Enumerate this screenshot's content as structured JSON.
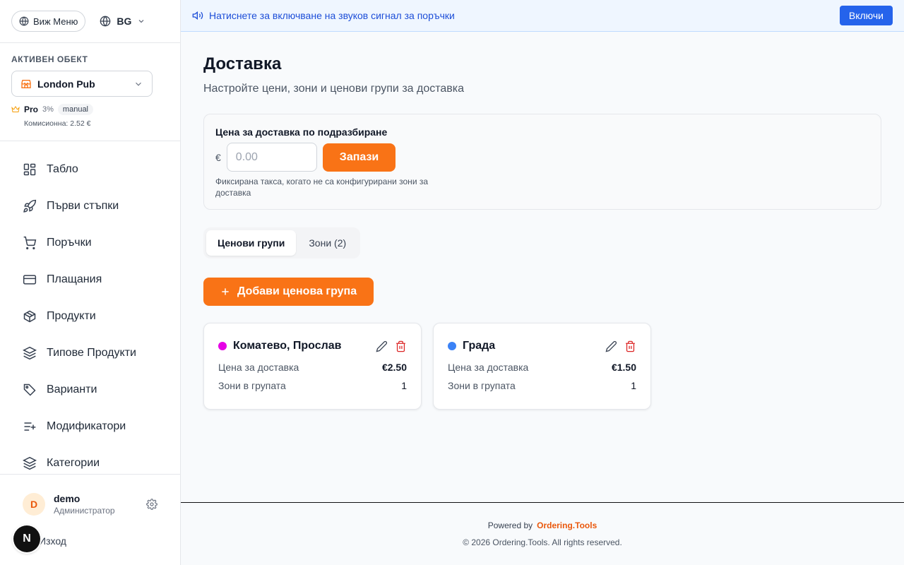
{
  "sidebar": {
    "menu_button": "Виж Меню",
    "language": "BG",
    "active_object_label": "Активен обект",
    "active_object": "London Pub",
    "plan": {
      "name": "Pro",
      "percent": "3%",
      "badge": "manual",
      "commission": "Комисионна: 2.52 €"
    },
    "nav": [
      {
        "label": "Табло",
        "icon": "dashboard-icon"
      },
      {
        "label": "Първи стъпки",
        "icon": "rocket-icon"
      },
      {
        "label": "Поръчки",
        "icon": "cart-icon"
      },
      {
        "label": "Плащания",
        "icon": "credit-card-icon"
      },
      {
        "label": "Продукти",
        "icon": "box-icon"
      },
      {
        "label": "Типове Продукти",
        "icon": "layers-icon"
      },
      {
        "label": "Варианти",
        "icon": "tag-icon"
      },
      {
        "label": "Модификатори",
        "icon": "list-plus-icon"
      },
      {
        "label": "Категории",
        "icon": "layers-icon"
      }
    ],
    "user": {
      "initial": "D",
      "name": "demo",
      "role": "Администратор",
      "logout": "Изход"
    },
    "dev_badge": "N"
  },
  "banner": {
    "text": "Натиснете за включване на звуков сигнал за поръчки",
    "button": "Включи"
  },
  "main": {
    "title": "Доставка",
    "subtitle": "Настройте цени, зони и ценови групи за доставка",
    "default_price": {
      "label": "Цена за доставка по подразбиране",
      "currency": "€",
      "placeholder": "0.00",
      "save": "Запази",
      "hint": "Фиксирана такса, когато не са конфигурирани зони за доставка"
    },
    "tabs": [
      {
        "label": "Ценови групи",
        "active": true
      },
      {
        "label": "Зони (2)",
        "active": false
      }
    ],
    "add_button": "Добави ценова група",
    "groups": [
      {
        "name": "Коматево, Прослав",
        "color": "#e600e6",
        "price_label": "Цена за доставка",
        "price": "€2.50",
        "zones_label": "Зони в групата",
        "zones": "1"
      },
      {
        "name": "Града",
        "color": "#3b82f6",
        "price_label": "Цена за доставка",
        "price": "€1.50",
        "zones_label": "Зони в групата",
        "zones": "1"
      }
    ]
  },
  "footer": {
    "powered_by": "Powered by",
    "brand": "Ordering.Tools",
    "copyright": "© 2026 Ordering.Tools. All rights reserved."
  },
  "colors": {
    "accent": "#f97316",
    "banner_button": "#2563eb",
    "banner_text": "#1d4ed8"
  }
}
